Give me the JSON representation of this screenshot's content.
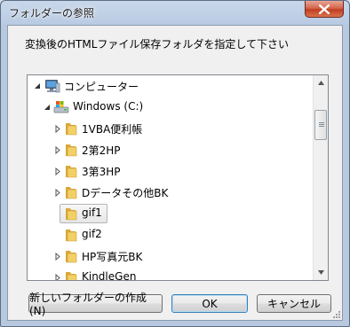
{
  "window": {
    "title": "フォルダーの参照"
  },
  "dialog": {
    "instruction": "変換後のHTMLファイル保存フォルダを指定して下さい"
  },
  "tree": {
    "items": [
      {
        "label": "コンピューター",
        "icon": "computer-icon",
        "expander": "expanded"
      },
      {
        "label": "Windows (C:)",
        "icon": "drive-icon",
        "expander": "expanded"
      },
      {
        "label": "1VBA便利帳",
        "icon": "folder-icon",
        "expander": "collapsed"
      },
      {
        "label": "2第2HP",
        "icon": "folder-icon",
        "expander": "collapsed"
      },
      {
        "label": "3第3HP",
        "icon": "folder-icon",
        "expander": "collapsed"
      },
      {
        "label": "Dデータその他BK",
        "icon": "folder-icon",
        "expander": "collapsed"
      },
      {
        "label": "gif1",
        "icon": "folder-icon",
        "expander": "none",
        "selected": true
      },
      {
        "label": "gif2",
        "icon": "folder-icon",
        "expander": "none"
      },
      {
        "label": "HP写真元BK",
        "icon": "folder-icon",
        "expander": "collapsed"
      },
      {
        "label": "KindleGen",
        "icon": "folder-icon",
        "expander": "collapsed"
      }
    ]
  },
  "buttons": {
    "new_folder": "新しいフォルダーの作成(N)",
    "ok": "OK",
    "cancel": "キャンセル"
  },
  "colors": {
    "selection_border": "#b4b4b4",
    "default_button_border": "#3c7fb1",
    "close_button": "#c23e22"
  }
}
